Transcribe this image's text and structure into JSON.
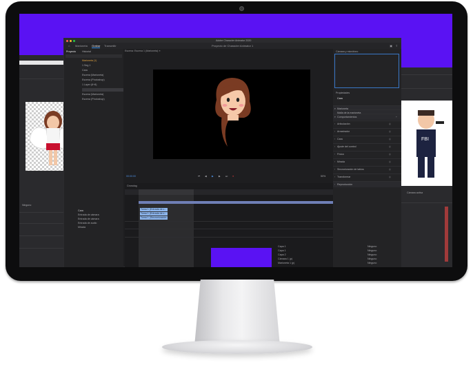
{
  "app": {
    "title": "Adobe Character Animator 2020",
    "project_title": "Proyecto de Character Animator 1",
    "tabs": [
      "Marioneta",
      "Grabar",
      "Transmitir"
    ],
    "active_tab": "Grabar"
  },
  "project_panel": {
    "tabs": [
      "Proyecto",
      "Historial"
    ],
    "items": [
      "Marioneta (1)",
      "1 Seg 1",
      "Cara",
      "Escena (Marioneta)",
      "Escena (Photoshop)",
      "1 Layer (8+8)",
      "Escena (Marioneta)",
      "Escena (Photoshop)"
    ]
  },
  "scene": {
    "label": "Escena: Escena 1 (Marioneta) ≡",
    "timecode": "00:00:00",
    "zoom": "50%"
  },
  "right_panel": {
    "camera_label": "Cámara y micrófono",
    "properties_label": "Propiedades",
    "puppet_name": "Cara",
    "sections": [
      "Marioneta",
      "Malla de la marioneta",
      "Comportamientos",
      "Articulación",
      "Arrastrador",
      "Cara",
      "Ajuste del control",
      "Física",
      "Mirada",
      "Sincronización de labios",
      "Transformar",
      "Reproducción"
    ]
  },
  "timeline": {
    "label": "Cronolog",
    "track_labels": [
      "Cara",
      "Entrada de cámara",
      "Entrada de cámara",
      "Entrada de audio",
      "Mirada"
    ],
    "selected_takes": [
      "Toma 1 (Entrada de c...",
      "Toma 1 (Entrada de c...",
      "Toma 1 (Sincronización..."
    ],
    "layers": [
      "Capa 1",
      "Capa 1",
      "Capa 2",
      "Cámara 1 (p)",
      "Marioneta 1 (p)"
    ],
    "blend": [
      "Ninguno",
      "Ninguno",
      "Ninguno",
      "Ninguno",
      "Ninguno"
    ]
  },
  "left_window": {
    "url": "Cámara activa",
    "label": "Ninguno"
  },
  "right_window": {
    "badge": "FBI",
    "label": "Cámara activa"
  },
  "colors": {
    "screen_bg": "#5a12f3",
    "app_bg": "#1e1e20",
    "accent_blue": "#3a8ee6",
    "highlight": "#e0a340"
  }
}
